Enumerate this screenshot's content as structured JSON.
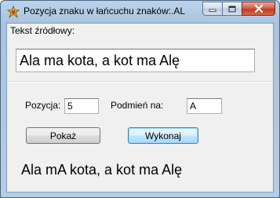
{
  "window": {
    "title": "Pozycja znaku w łańcuchu znaków:.AL",
    "icon": "app-icon",
    "caption_buttons": [
      "minimize",
      "maximize",
      "close"
    ],
    "colors": {
      "title_bar": "#b9d1ea",
      "client_background": "#f0f0f0",
      "close_button": "#c23c23"
    }
  },
  "source": {
    "label": "Tekst źródłowy:",
    "value": "Ala ma kota, a kot ma Alę"
  },
  "position": {
    "label": "Pozycja:",
    "value": "5"
  },
  "replace": {
    "label": "Podmień na:",
    "value": "A"
  },
  "buttons": {
    "show_label": "Pokaż",
    "execute_label": "Wykonaj"
  },
  "result": {
    "text": "Ala mA kota, a kot ma Alę"
  }
}
